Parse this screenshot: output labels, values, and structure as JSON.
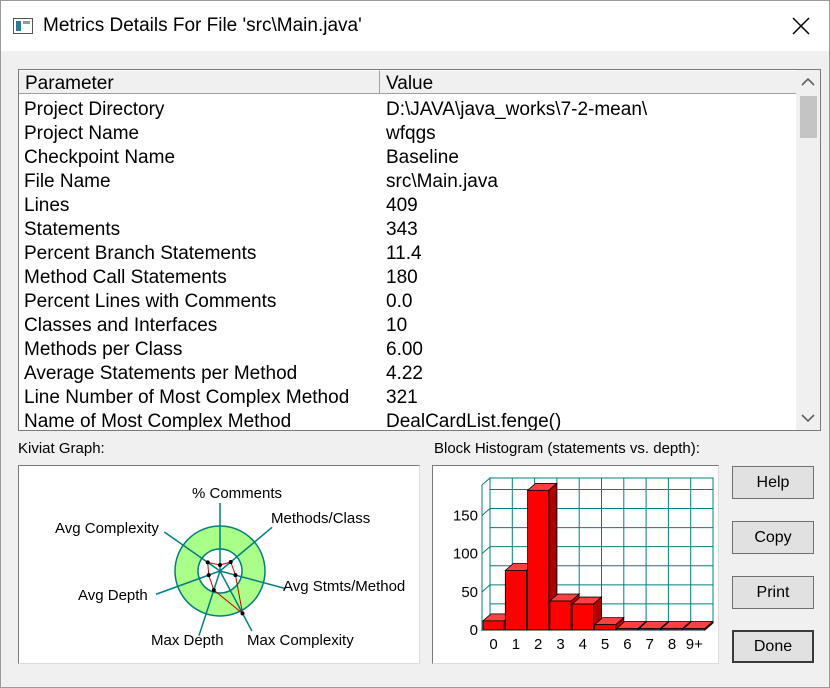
{
  "window": {
    "title": "Metrics Details For File 'src\\Main.java'"
  },
  "table": {
    "headers": {
      "parameter": "Parameter",
      "value": "Value"
    },
    "rows": [
      {
        "param": "Project Directory",
        "value": "D:\\JAVA\\java_works\\7-2-mean\\"
      },
      {
        "param": "Project Name",
        "value": "wfqgs"
      },
      {
        "param": "Checkpoint Name",
        "value": "Baseline"
      },
      {
        "param": "File Name",
        "value": "src\\Main.java"
      },
      {
        "param": "Lines",
        "value": "409"
      },
      {
        "param": "Statements",
        "value": "343"
      },
      {
        "param": "Percent Branch Statements",
        "value": "11.4"
      },
      {
        "param": "Method Call Statements",
        "value": "180"
      },
      {
        "param": "Percent Lines with Comments",
        "value": "0.0"
      },
      {
        "param": "Classes and Interfaces",
        "value": "10"
      },
      {
        "param": "Methods per Class",
        "value": "6.00"
      },
      {
        "param": "Average Statements per Method",
        "value": "4.22"
      },
      {
        "param": "Line Number of Most Complex Method",
        "value": "321"
      },
      {
        "param": "Name of Most Complex Method",
        "value": "DealCardList.fenge()"
      }
    ]
  },
  "kiviat": {
    "label": "Kiviat Graph:",
    "axes": [
      "% Comments",
      "Methods/Class",
      "Avg Stmts/Method",
      "Max Complexity",
      "Max Depth",
      "Avg Depth",
      "Avg Complexity"
    ],
    "ring_color": "#aaff88",
    "line_color": "#008080",
    "plot_color": "#cc0000"
  },
  "histogram": {
    "label": "Block Histogram (statements vs. depth):",
    "bar_color": "#ff0000",
    "grid_color": "#008080"
  },
  "buttons": {
    "help": "Help",
    "copy": "Copy",
    "print": "Print",
    "done": "Done"
  },
  "chart_data": {
    "type": "bar",
    "categories": [
      "0",
      "1",
      "2",
      "3",
      "4",
      "5",
      "6",
      "7",
      "8",
      "9+"
    ],
    "values": [
      12,
      78,
      183,
      38,
      34,
      7,
      2,
      2,
      2,
      2
    ],
    "yticks": [
      0,
      50,
      100,
      150
    ],
    "ylim": [
      0,
      190
    ]
  }
}
